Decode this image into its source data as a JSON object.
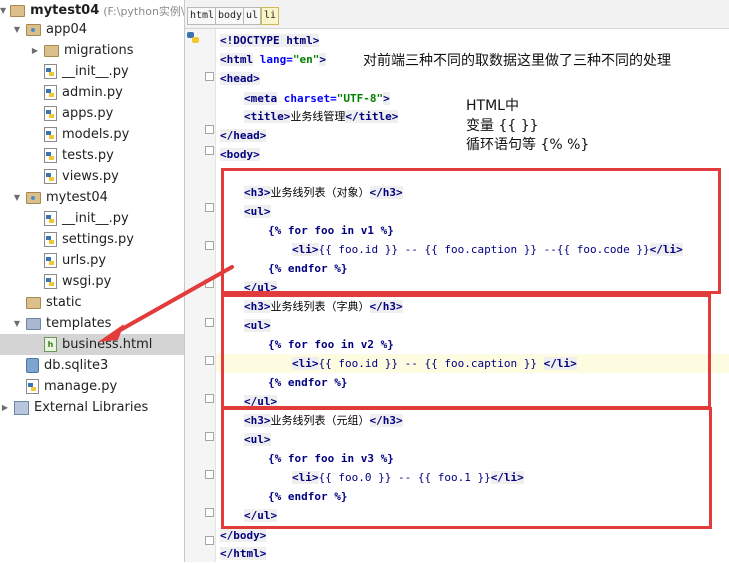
{
  "tree": {
    "project": "mytest04",
    "project_path": "(F:\\python实例\\m",
    "items": [
      {
        "label": "app04",
        "icon": "package-folder-icon"
      },
      {
        "label": "migrations",
        "icon": "folder-icon"
      },
      {
        "label": "__init__.py",
        "icon": "python-file-icon"
      },
      {
        "label": "admin.py",
        "icon": "python-file-icon"
      },
      {
        "label": "apps.py",
        "icon": "python-file-icon"
      },
      {
        "label": "models.py",
        "icon": "python-file-icon"
      },
      {
        "label": "tests.py",
        "icon": "python-file-icon"
      },
      {
        "label": "views.py",
        "icon": "python-file-icon"
      },
      {
        "label": "mytest04",
        "icon": "package-folder-icon"
      },
      {
        "label": "__init__.py",
        "icon": "python-file-icon"
      },
      {
        "label": "settings.py",
        "icon": "python-file-icon"
      },
      {
        "label": "urls.py",
        "icon": "python-file-icon"
      },
      {
        "label": "wsgi.py",
        "icon": "python-file-icon"
      },
      {
        "label": "static",
        "icon": "folder-icon"
      },
      {
        "label": "templates",
        "icon": "templates-folder-icon"
      },
      {
        "label": "business.html",
        "icon": "html-file-icon"
      },
      {
        "label": "db.sqlite3",
        "icon": "database-file-icon"
      },
      {
        "label": "manage.py",
        "icon": "python-file-icon"
      },
      {
        "label": "External Libraries",
        "icon": "library-icon"
      }
    ]
  },
  "breadcrumbs": [
    "html",
    "body",
    "ul",
    "li"
  ],
  "code": {
    "l1": "<!DOCTYPE html>",
    "l2_tag": "<html",
    "l2_attr": " lang=",
    "l2_str": "\"en\"",
    "l2_end": ">",
    "l3": "<head>",
    "l4_tag": "<meta",
    "l4_attr": " charset=",
    "l4_str": "\"UTF-8\"",
    "l4_end": ">",
    "l5_open": "<title>",
    "l5_text": "业务线管理",
    "l5_close": "</title>",
    "l6": "</head>",
    "l7": "<body>",
    "l8_open": "<h3>",
    "l8_text": "业务线列表（对象）",
    "l8_close": "</h3>",
    "ul_open": "<ul>",
    "for1": "{% for foo in v1 %}",
    "li_open": "<li>",
    "li1_body": "{{ foo.id }} -- {{ foo.caption }} --{{ foo.code }}",
    "li_close": "</li>",
    "endfor": "{% endfor %}",
    "ul_close": "</ul>",
    "h3b_text": "业务线列表（字典）",
    "for2": "{% for foo in v2 %}",
    "li2_body": "{{ foo.id }} -- {{ foo.caption }} ",
    "h3c_text": "业务线列表（元组）",
    "for3": "{% for foo in v3 %}",
    "li3_body": "{{ foo.0 }} -- {{ foo.1 }}",
    "body_close": "</body>",
    "html_close": "</html>"
  },
  "notes": {
    "top": "对前端三种不同的取数据这里做了三种不同的处理",
    "html_title": "HTML中",
    "variable": "变量  {{ }}",
    "loop": "循环语句等 {%   %}"
  },
  "colors": {
    "annotation_red": "#e23b3b",
    "selected_row": "#d4d4d4",
    "current_line": "#fdfbe0"
  }
}
